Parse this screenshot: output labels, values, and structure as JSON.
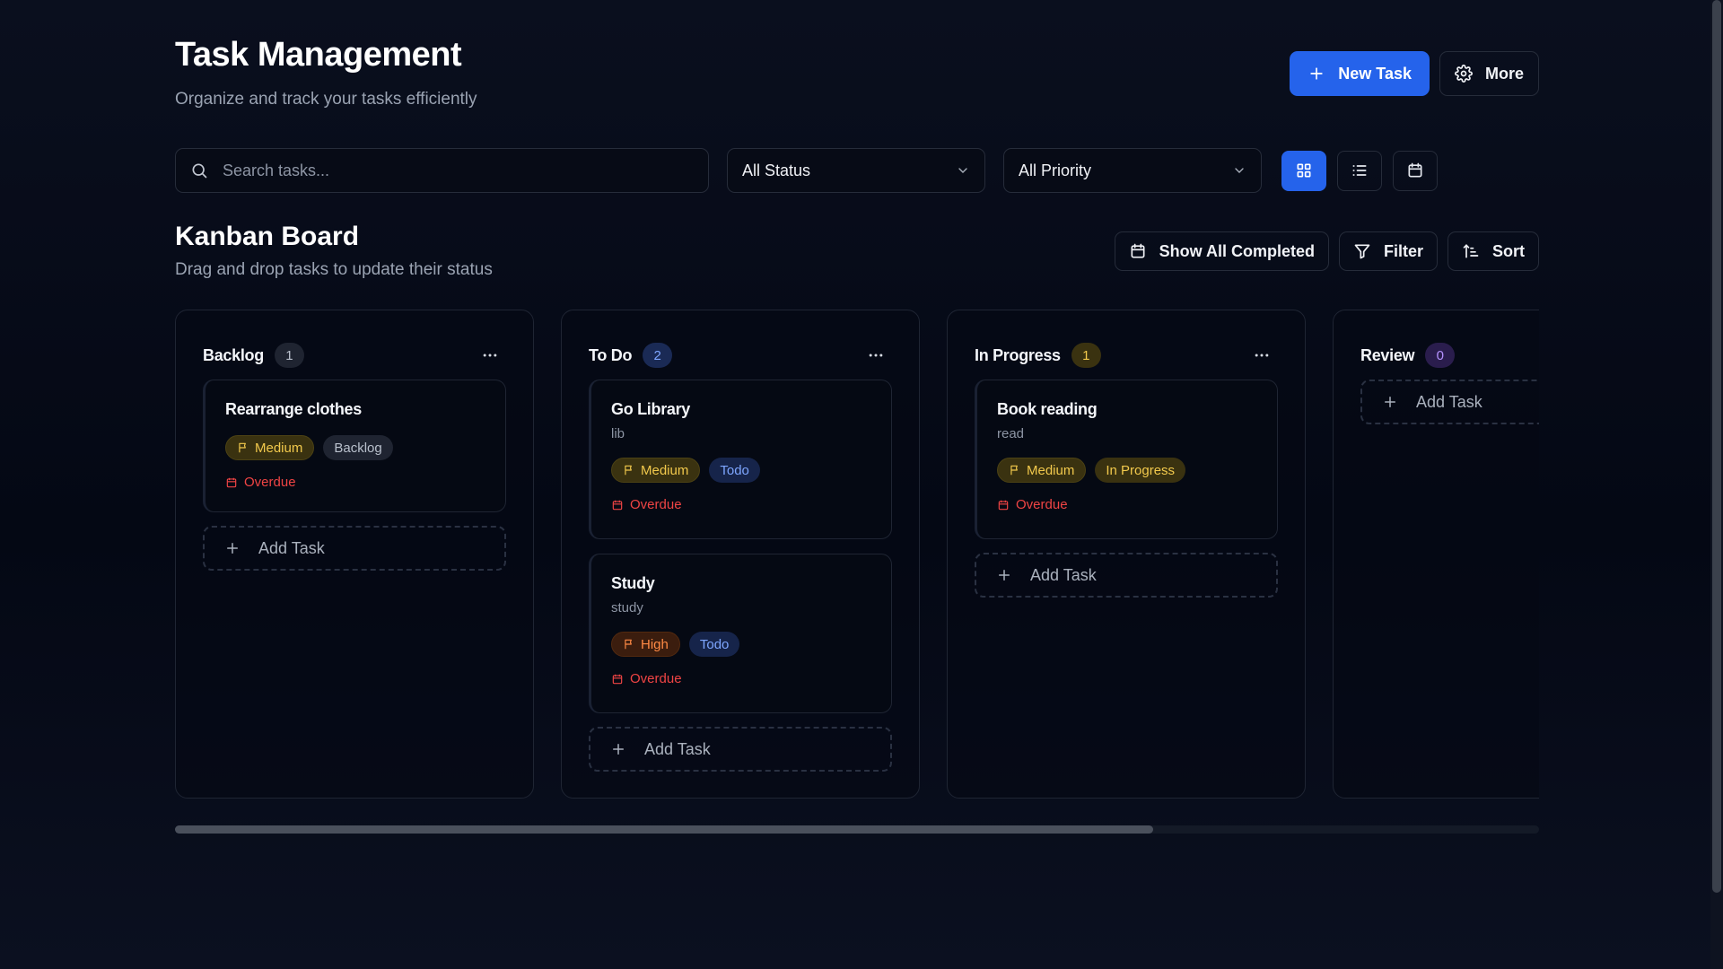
{
  "header": {
    "title": "Task Management",
    "subtitle": "Organize and track your tasks efficiently",
    "new_task_label": "New Task",
    "more_label": "More"
  },
  "toolbar": {
    "search_placeholder": "Search tasks...",
    "status_filter": "All Status",
    "priority_filter": "All Priority",
    "views": [
      "grid-view",
      "list-view",
      "calendar-view"
    ],
    "active_view": "grid-view"
  },
  "board": {
    "title": "Kanban Board",
    "subtitle": "Drag and drop tasks to update their status",
    "show_completed_label": "Show All Completed",
    "filter_label": "Filter",
    "sort_label": "Sort",
    "add_task_label": "Add Task",
    "columns": [
      {
        "title": "Backlog",
        "count": "1",
        "tasks": [
          {
            "title": "Rearrange clothes",
            "desc": "",
            "priority": "Medium",
            "status": "Backlog",
            "due": "Overdue"
          }
        ]
      },
      {
        "title": "To Do",
        "count": "2",
        "tasks": [
          {
            "title": "Go Library",
            "desc": "lib",
            "priority": "Medium",
            "status": "Todo",
            "due": "Overdue"
          },
          {
            "title": "Study",
            "desc": "study",
            "priority": "High",
            "status": "Todo",
            "due": "Overdue"
          }
        ]
      },
      {
        "title": "In Progress",
        "count": "1",
        "tasks": [
          {
            "title": "Book reading",
            "desc": "read",
            "priority": "Medium",
            "status": "In Progress",
            "due": "Overdue"
          }
        ]
      },
      {
        "title": "Review",
        "count": "0",
        "tasks": []
      }
    ]
  },
  "colors": {
    "accent": "#2563eb",
    "background": "#050913",
    "overdue": "#ef4444",
    "medium": "#f2c94c",
    "high": "#ff8a45"
  }
}
